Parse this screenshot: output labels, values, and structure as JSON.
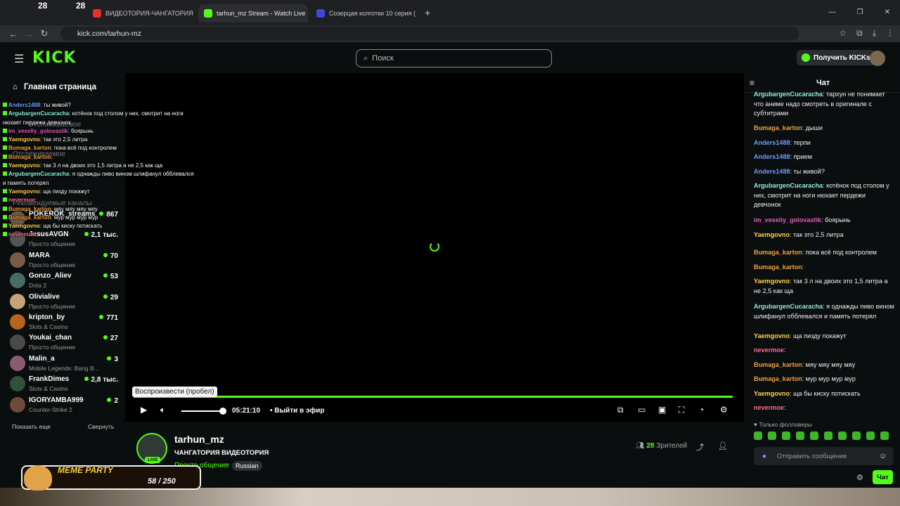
{
  "browser": {
    "tab_counter_1": "28",
    "tab_counter_2": "28",
    "tabs": [
      {
        "label": "ВИДЕОТОРИЯ-ЧАНГАТОРИЯ",
        "color": "#e0322b"
      },
      {
        "label": "tarhun_mz Stream - Watch Live",
        "color": "#53fc18"
      },
      {
        "label": "Созерцая колготки 10 серия (",
        "color": "#3a4bd8"
      }
    ],
    "url": "kick.com/tarhun-mz"
  },
  "header": {
    "logo": "KICK",
    "search_placeholder": "Поиск",
    "get_kicks_label": "Получить KICKs"
  },
  "sidebar": {
    "home_label": "Главная страница",
    "faded": [
      "Отслеживаемое",
      "Отслеживаемое",
      "Рекомендуемые каналы"
    ],
    "channels": [
      {
        "name": "POKEROK_streams",
        "category": "",
        "viewers": "867",
        "color": "#6b5a4a"
      },
      {
        "name": "JesusAVGN",
        "category": "Просто общение",
        "viewers": "2,1 тыс.",
        "color": "#555"
      },
      {
        "name": "MARA",
        "category": "Просто общение",
        "viewers": "70",
        "color": "#7a5a48"
      },
      {
        "name": "Gonzo_Aliev",
        "category": "Dota 2",
        "viewers": "53",
        "color": "#4a6b63"
      },
      {
        "name": "Olivialive",
        "category": "Просто общение",
        "viewers": "29",
        "color": "#c7a37a"
      },
      {
        "name": "kripton_by",
        "category": "Slots & Casino",
        "viewers": "771",
        "color": "#b8641f"
      },
      {
        "name": "Youkai_chan",
        "category": "Просто общение",
        "viewers": "27",
        "color": "#4a4a4a"
      },
      {
        "name": "Malin_a",
        "category": "Mobile Legends: Bang B...",
        "viewers": "3",
        "color": "#8a5c6e"
      },
      {
        "name": "FrankDimes",
        "category": "Slots & Casino",
        "viewers": "2,8 тыс.",
        "color": "#30513a"
      },
      {
        "name": "IGORYAMBA999",
        "category": "Counter-Strike 2",
        "viewers": "2",
        "color": "#6e4a3a"
      }
    ],
    "show_more": "Показать еще",
    "collapse": "Свернуть"
  },
  "overlay_chat": [
    {
      "user": "Anders1488",
      "text": ": ты живой?",
      "color": "#6f9cff"
    },
    {
      "user": "ArgubargenCucaracha",
      "text": ": котёнок под столом у них, смотрит на ноги нюхает пердежи девчонок",
      "color": "#8af0d8"
    },
    {
      "user": "im_veseliy_golovastik",
      "text": ": боярынь",
      "color": "#e25cc0"
    },
    {
      "user": "Yaemgovno",
      "text": ": так это 2,5 литра",
      "color": "#ffd44a"
    },
    {
      "user": "Bumaga_karton",
      "text": ": пока всё под контролем",
      "color": "#f0a040"
    },
    {
      "user": "Bumaga_karton",
      "text": ":",
      "color": "#f0a040"
    },
    {
      "user": "Yaemgovno",
      "text": ": так 3 л на двоих это 1,5 литра а не 2,5 как ща",
      "color": "#ffd44a"
    },
    {
      "user": "ArgubargenCucaracha",
      "text": ": я однажды пиво вином шлифанул обблевался и память потерял",
      "color": "#8af0d8"
    },
    {
      "user": "Yaemgovno",
      "text": ": ща пизду покажут",
      "color": "#ffd44a"
    },
    {
      "user": "nevermoe",
      "text": ":",
      "color": "#ff6b8a"
    },
    {
      "user": "Bumaga_karton",
      "text": ": мяу мяу мяу мяу",
      "color": "#f0a040"
    },
    {
      "user": "Bumaga_karton",
      "text": ": мур мур мур мур",
      "color": "#f0a040"
    },
    {
      "user": "Yaemgovno",
      "text": ": ща бы киску потискать",
      "color": "#ffd44a"
    },
    {
      "user": "nevermoe",
      "text": ":",
      "color": "#ff6b8a"
    }
  ],
  "player": {
    "tooltip": "Воспроизвести (пробел)",
    "time": "05:21:10",
    "go_live": "Выйти в эфир",
    "volume_level": 0.9
  },
  "stream": {
    "channel": "tarhun_mz",
    "live_badge": "LIVE",
    "title": "ЧАНГАТОРИЯ ВИДЕОТОРИЯ",
    "category": "Просто общение",
    "language": "Russian",
    "viewer_count": "28",
    "viewer_label": "Зрителей"
  },
  "chat": {
    "title": "Чат",
    "messages": [
      {
        "user": "ArgubargenCucaracha",
        "text": ": тархун не понимает что аниме надо смотреть в оригинале с субтитрами",
        "color": "#8af0d8"
      },
      {
        "user": "Bumaga_karton",
        "text": ": дыши",
        "color": "#f0a040"
      },
      {
        "user": "Anders1488",
        "text": ": терпи",
        "color": "#6f9cff"
      },
      {
        "user": "Anders1488",
        "text": ": прием",
        "color": "#6f9cff"
      },
      {
        "user": "Anders1488",
        "text": ": ты живой?",
        "color": "#6f9cff"
      },
      {
        "user": "ArgubargenCucaracha",
        "text": ": котёнок под столом у них, смотрит на ноги нюхает пердежи девчонок",
        "color": "#8af0d8"
      },
      {
        "user": "im_veseliy_golovastik",
        "text": ": боярынь",
        "color": "#e25cc0"
      },
      {
        "user": "Yaemgovno",
        "text": ": так это 2,5 литра",
        "color": "#ffd44a"
      },
      {
        "user": "Bumaga_karton",
        "text": ": пока всё под контролем",
        "color": "#f0a040"
      },
      {
        "user": "Bumaga_karton",
        "text": ":",
        "color": "#f0a040"
      },
      {
        "user": "Yaemgovno",
        "text": ": так 3 л на двоих это 1,5 литра а не 2,5 как ща",
        "color": "#ffd44a"
      },
      {
        "user": "ArgubargenCucaracha",
        "text": ": я однажды пиво вином шлифанул обблевался и память потерял",
        "color": "#8af0d8"
      },
      {
        "user": "Yaemgovno",
        "text": ": ща пизду покажут",
        "color": "#ffd44a"
      },
      {
        "user": "nevermoe",
        "text": ":",
        "color": "#ff6b8a"
      },
      {
        "user": "Bumaga_karton",
        "text": ": мяу мяу мяу мяу",
        "color": "#f0a040"
      },
      {
        "user": "Bumaga_karton",
        "text": ": мур мур мур мур",
        "color": "#f0a040"
      },
      {
        "user": "Yaemgovno",
        "text": ": ща бы киску потискать",
        "color": "#ffd44a"
      },
      {
        "user": "nevermoe",
        "text": ":",
        "color": "#ff6b8a"
      }
    ],
    "followers_only": "Только фолловеры",
    "input_placeholder": "Отправить сообщение",
    "send_label": "Чат"
  },
  "meme_party": {
    "title": "MEME PARTY",
    "progress": "58 / 250"
  },
  "colors": {
    "accent": "#53fc18"
  }
}
